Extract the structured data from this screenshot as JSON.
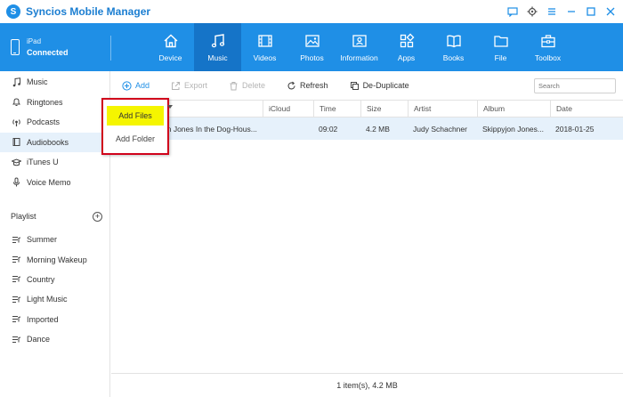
{
  "app": {
    "title": "Syncios Mobile Manager",
    "logo_letter": "S"
  },
  "device": {
    "name": "iPad",
    "status": "Connected"
  },
  "nav": {
    "tabs": [
      {
        "label": "Device",
        "icon": "home-icon"
      },
      {
        "label": "Music",
        "icon": "music-note-icon",
        "active": true
      },
      {
        "label": "Videos",
        "icon": "film-icon"
      },
      {
        "label": "Photos",
        "icon": "image-icon"
      },
      {
        "label": "Information",
        "icon": "contact-card-icon"
      },
      {
        "label": "Apps",
        "icon": "apps-grid-icon"
      },
      {
        "label": "Books",
        "icon": "open-book-icon"
      },
      {
        "label": "File",
        "icon": "folder-icon"
      },
      {
        "label": "Toolbox",
        "icon": "toolbox-icon"
      }
    ]
  },
  "sidebar": {
    "items": [
      {
        "label": "Music",
        "icon": "music-note-icon"
      },
      {
        "label": "Ringtones",
        "icon": "bell-icon"
      },
      {
        "label": "Podcasts",
        "icon": "podcast-icon"
      },
      {
        "label": "Audiobooks",
        "icon": "book-icon",
        "active": true
      },
      {
        "label": "iTunes U",
        "icon": "graduation-cap-icon"
      },
      {
        "label": "Voice Memo",
        "icon": "microphone-icon"
      }
    ],
    "playlist_label": "Playlist",
    "playlist_add": "+",
    "playlists": [
      "Summer",
      "Morning Wakeup",
      "Country",
      "Light Music",
      "Imported",
      "Dance"
    ]
  },
  "toolbar": {
    "add": "Add",
    "export": "Export",
    "delete": "Delete",
    "refresh": "Refresh",
    "dedupe": "De-Duplicate",
    "search_placeholder": "Search"
  },
  "table": {
    "columns": [
      "",
      "iCloud",
      "Time",
      "Size",
      "Artist",
      "Album",
      "Date"
    ],
    "rows": [
      {
        "name": "on Jones In the Dog-Hous...",
        "icloud": "",
        "time": "09:02",
        "size": "4.2 MB",
        "artist": "Judy Schachner",
        "album": "Skippyjon Jones...",
        "date": "2018-01-25"
      }
    ]
  },
  "dropdown": {
    "items": [
      "Add Files",
      "Add Folder"
    ],
    "highlight_color": "#f5f500",
    "border_color": "#d0021b"
  },
  "status": "1 item(s), 4.2 MB",
  "colors": {
    "accent": "#1f8fe6",
    "active_tab": "#1574c8",
    "selected_row": "#e6f1fb"
  }
}
